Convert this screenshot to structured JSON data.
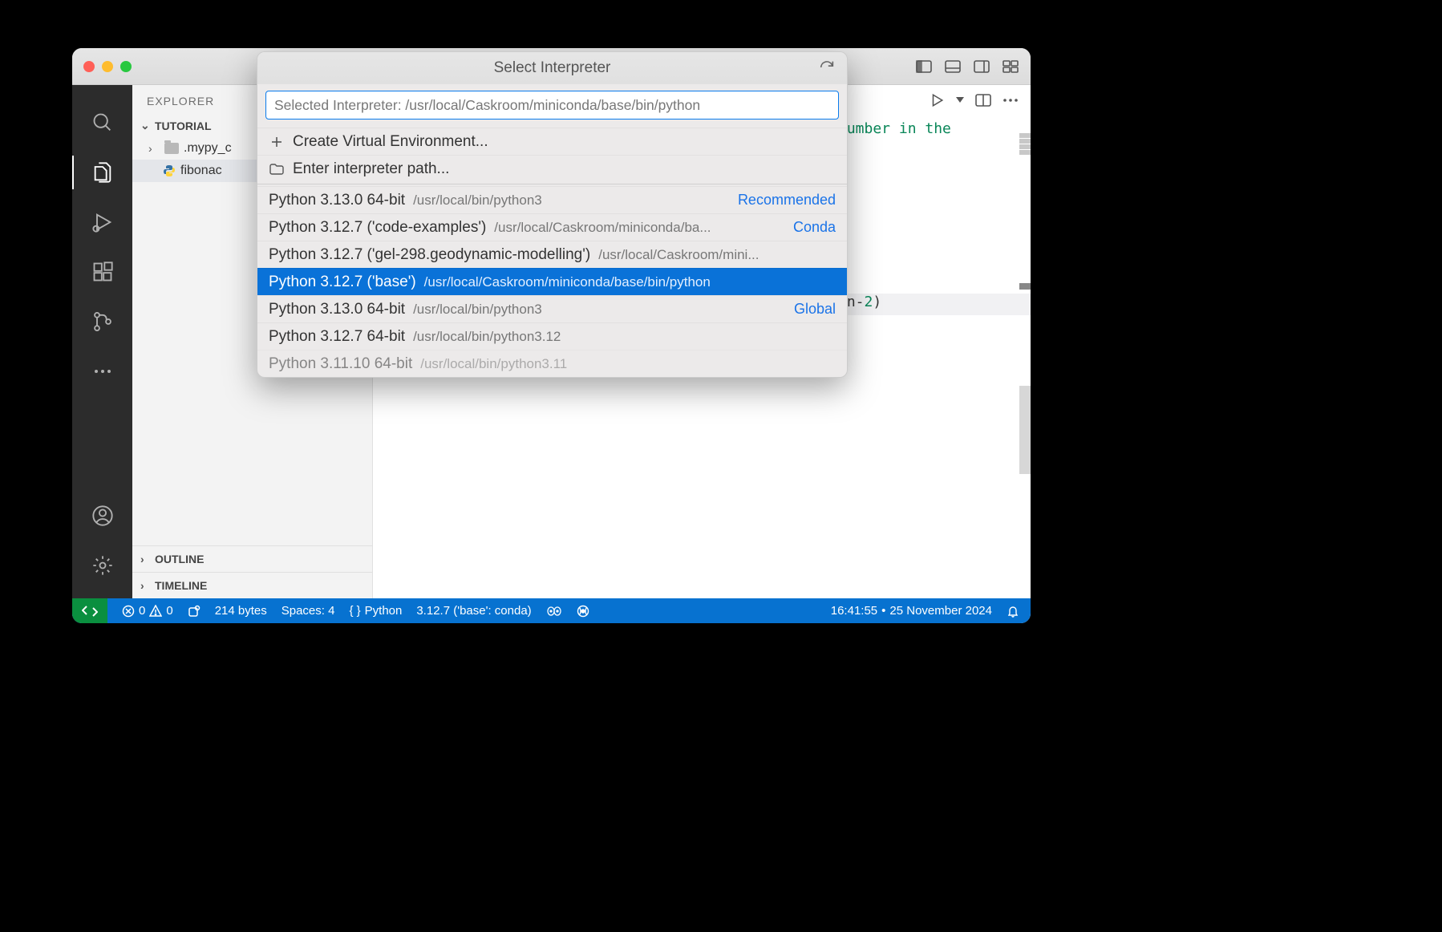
{
  "quickpick": {
    "title": "Select Interpreter",
    "input_value": "Selected Interpreter: /usr/local/Caskroom/miniconda/base/bin/python",
    "create_venv": "Create Virtual Environment...",
    "enter_path": "Enter interpreter path...",
    "items": [
      {
        "label": "Python 3.13.0 64-bit",
        "detail": "/usr/local/bin/python3",
        "tag": "Recommended"
      },
      {
        "label": "Python 3.12.7 ('code-examples')",
        "detail": "/usr/local/Caskroom/miniconda/ba...",
        "tag": "Conda"
      },
      {
        "label": "Python 3.12.7 ('gel-298.geodynamic-modelling')",
        "detail": "/usr/local/Caskroom/mini...",
        "tag": ""
      },
      {
        "label": "Python 3.12.7 ('base')",
        "detail": "/usr/local/Caskroom/miniconda/base/bin/python",
        "tag": "",
        "selected": true
      },
      {
        "label": "Python 3.13.0 64-bit",
        "detail": "/usr/local/bin/python3",
        "tag": "Global"
      },
      {
        "label": "Python 3.12.7 64-bit",
        "detail": "/usr/local/bin/python3.12",
        "tag": ""
      },
      {
        "label": "Python 3.11.10 64-bit",
        "detail": "/usr/local/bin/python3.11",
        "tag": "",
        "partial": true
      }
    ]
  },
  "sidebar": {
    "title": "EXPLORER",
    "project": "TUTORIAL",
    "folder": ".mypy_c",
    "file": "fibonac",
    "outline": "OUTLINE",
    "timeline": "TIMELINE"
  },
  "editor": {
    "code_frag_1": "number in the",
    "code_frag_2": "(n-",
    "code_frag_3": "2",
    "code_frag_4": ")"
  },
  "status": {
    "errors": "0",
    "warnings": "0",
    "size": "214 bytes",
    "spaces": "Spaces: 4",
    "lang": "Python",
    "interpreter": "3.12.7 ('base': conda)",
    "time": "16:41:55",
    "bullet": "•",
    "date": "25 November 2024"
  }
}
